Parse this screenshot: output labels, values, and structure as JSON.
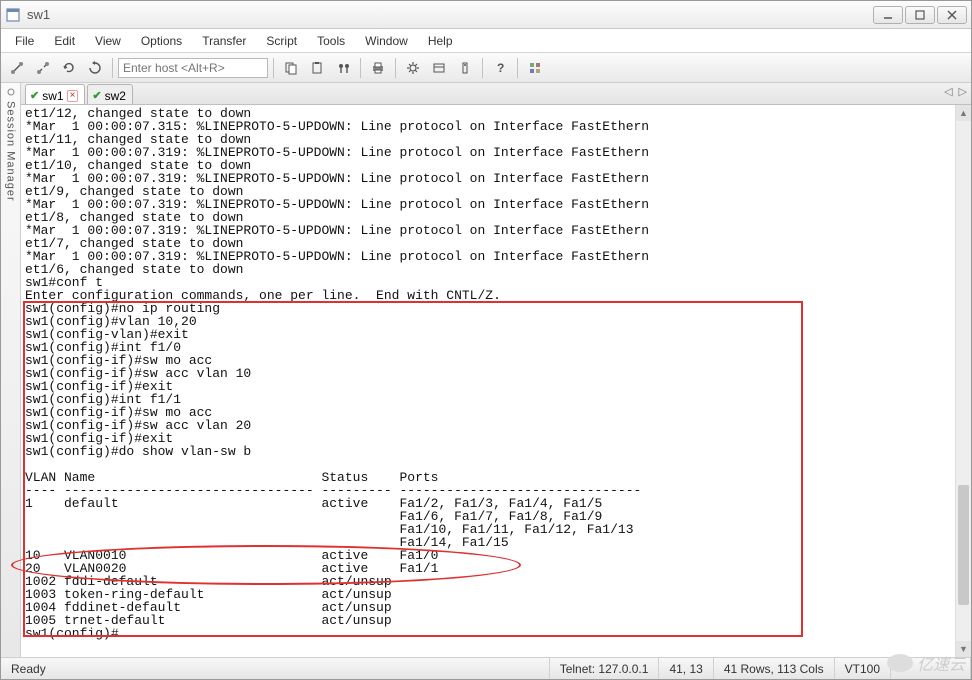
{
  "window": {
    "title": "sw1"
  },
  "menu": {
    "items": [
      "File",
      "Edit",
      "View",
      "Options",
      "Transfer",
      "Script",
      "Tools",
      "Window",
      "Help"
    ]
  },
  "toolbar": {
    "host_placeholder": "Enter host <Alt+R>"
  },
  "side_panel": {
    "label": "Session Manager"
  },
  "tabs": {
    "0": {
      "label": "sw1"
    },
    "1": {
      "label": "sw2"
    }
  },
  "terminal": {
    "log_lines": [
      "et1/12, changed state to down",
      "*Mar  1 00:00:07.315: %LINEPROTO-5-UPDOWN: Line protocol on Interface FastEthern",
      "et1/11, changed state to down",
      "*Mar  1 00:00:07.319: %LINEPROTO-5-UPDOWN: Line protocol on Interface FastEthern",
      "et1/10, changed state to down",
      "*Mar  1 00:00:07.319: %LINEPROTO-5-UPDOWN: Line protocol on Interface FastEthern",
      "et1/9, changed state to down",
      "*Mar  1 00:00:07.319: %LINEPROTO-5-UPDOWN: Line protocol on Interface FastEthern",
      "et1/8, changed state to down",
      "*Mar  1 00:00:07.319: %LINEPROTO-5-UPDOWN: Line protocol on Interface FastEthern",
      "et1/7, changed state to down",
      "*Mar  1 00:00:07.319: %LINEPROTO-5-UPDOWN: Line protocol on Interface FastEthern",
      "et1/6, changed state to down",
      "sw1#conf t",
      "Enter configuration commands, one per line.  End with CNTL/Z.",
      "sw1(config)#no ip routing",
      "sw1(config)#vlan 10,20",
      "sw1(config-vlan)#exit",
      "sw1(config)#int f1/0",
      "sw1(config-if)#sw mo acc",
      "sw1(config-if)#sw acc vlan 10",
      "sw1(config-if)#exit",
      "sw1(config)#int f1/1",
      "sw1(config-if)#sw mo acc",
      "sw1(config-if)#sw acc vlan 20",
      "sw1(config-if)#exit",
      "sw1(config)#do show vlan-sw b",
      "",
      "VLAN Name                             Status    Ports",
      "---- -------------------------------- --------- -------------------------------",
      "1    default                          active    Fa1/2, Fa1/3, Fa1/4, Fa1/5",
      "                                                Fa1/6, Fa1/7, Fa1/8, Fa1/9",
      "                                                Fa1/10, Fa1/11, Fa1/12, Fa1/13",
      "                                                Fa1/14, Fa1/15",
      "10   VLAN0010                         active    Fa1/0",
      "20   VLAN0020                         active    Fa1/1",
      "1002 fddi-default                     act/unsup",
      "1003 token-ring-default               act/unsup",
      "1004 fddinet-default                  act/unsup",
      "1005 trnet-default                    act/unsup",
      "sw1(config)#"
    ],
    "vlan_table": {
      "headers": [
        "VLAN",
        "Name",
        "Status",
        "Ports"
      ],
      "rows": [
        {
          "vlan": "1",
          "name": "default",
          "status": "active",
          "ports": "Fa1/2, Fa1/3, Fa1/4, Fa1/5, Fa1/6, Fa1/7, Fa1/8, Fa1/9, Fa1/10, Fa1/11, Fa1/12, Fa1/13, Fa1/14, Fa1/15"
        },
        {
          "vlan": "10",
          "name": "VLAN0010",
          "status": "active",
          "ports": "Fa1/0"
        },
        {
          "vlan": "20",
          "name": "VLAN0020",
          "status": "active",
          "ports": "Fa1/1"
        },
        {
          "vlan": "1002",
          "name": "fddi-default",
          "status": "act/unsup",
          "ports": ""
        },
        {
          "vlan": "1003",
          "name": "token-ring-default",
          "status": "act/unsup",
          "ports": ""
        },
        {
          "vlan": "1004",
          "name": "fddinet-default",
          "status": "act/unsup",
          "ports": ""
        },
        {
          "vlan": "1005",
          "name": "trnet-default",
          "status": "act/unsup",
          "ports": ""
        }
      ]
    }
  },
  "status": {
    "ready": "Ready",
    "conn": "Telnet: 127.0.0.1",
    "cursor": "41, 13",
    "size": "41 Rows, 113 Cols",
    "term": "VT100"
  },
  "watermark": "亿速云"
}
